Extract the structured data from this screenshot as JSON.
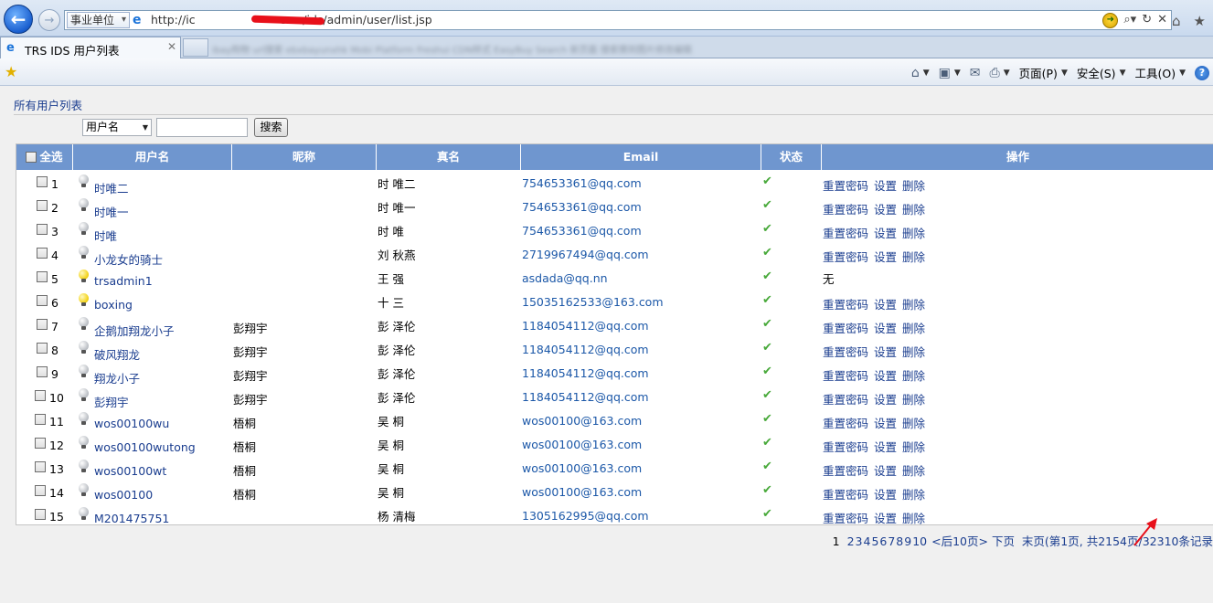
{
  "browser": {
    "zone_label": "事业单位",
    "url_prefix": "http://ic",
    "url_suffix": "c.cn/ids/admin/user/list.jsp",
    "tab_title": "TRS IDS 用户列表",
    "blurred_tabs": "ibay购物 url搜索   ebxbayunxhk   Mobi Platform   Freshui CDN样式   EasyBuy Search   新页面   搜索猜到图片修改编辑",
    "menu": {
      "page": "页面(P)",
      "safety": "安全(S)",
      "tools": "工具(O)"
    }
  },
  "page": {
    "breadcrumb": "所有用户列表",
    "search": {
      "field": "用户名",
      "value": "",
      "button": "搜索"
    },
    "table": {
      "headers": {
        "select_all": "全选",
        "username": "用户名",
        "nickname": "昵称",
        "realname": "真名",
        "email": "Email",
        "status": "状态",
        "actions": "操作"
      },
      "action_labels": {
        "reset": "重置密码",
        "settings": "设置",
        "delete": "删除"
      },
      "rows": [
        {
          "no": "1",
          "username": "时唯二",
          "nickname": "",
          "realname": "时 唯二",
          "email": "754653361@qq.com",
          "active": false,
          "actions": "links"
        },
        {
          "no": "2",
          "username": "时唯一",
          "nickname": "",
          "realname": "时 唯一",
          "email": "754653361@qq.com",
          "active": false,
          "actions": "links"
        },
        {
          "no": "3",
          "username": "时唯",
          "nickname": "",
          "realname": "时 唯",
          "email": "754653361@qq.com",
          "active": false,
          "actions": "links"
        },
        {
          "no": "4",
          "username": "小龙女的骑士",
          "nickname": "",
          "realname": "刘 秋燕",
          "email": "2719967494@qq.com",
          "active": false,
          "actions": "links"
        },
        {
          "no": "5",
          "username": "trsadmin1",
          "nickname": "",
          "realname": "王 强",
          "email": "asdada@qq.nn",
          "active": true,
          "actions": "无"
        },
        {
          "no": "6",
          "username": "boxing",
          "nickname": "",
          "realname": "十 三",
          "email": "15035162533@163.com",
          "active": true,
          "actions": "links"
        },
        {
          "no": "7",
          "username": "企鹅加翔龙小子",
          "nickname": "彭翔宇",
          "realname": "彭 泽伦",
          "email": "1184054112@qq.com",
          "active": false,
          "actions": "links"
        },
        {
          "no": "8",
          "username": "破风翔龙",
          "nickname": "彭翔宇",
          "realname": "彭 泽伦",
          "email": "1184054112@qq.com",
          "active": false,
          "actions": "links"
        },
        {
          "no": "9",
          "username": "翔龙小子",
          "nickname": "彭翔宇",
          "realname": "彭 泽伦",
          "email": "1184054112@qq.com",
          "active": false,
          "actions": "links"
        },
        {
          "no": "10",
          "username": "彭翔宇",
          "nickname": "彭翔宇",
          "realname": "彭 泽伦",
          "email": "1184054112@qq.com",
          "active": false,
          "actions": "links"
        },
        {
          "no": "11",
          "username": "wos00100wu",
          "nickname": "梧桐",
          "realname": "吴 桐",
          "email": "wos00100@163.com",
          "active": false,
          "actions": "links"
        },
        {
          "no": "12",
          "username": "wos00100wutong",
          "nickname": "梧桐",
          "realname": "吴 桐",
          "email": "wos00100@163.com",
          "active": false,
          "actions": "links"
        },
        {
          "no": "13",
          "username": "wos00100wt",
          "nickname": "梧桐",
          "realname": "吴 桐",
          "email": "wos00100@163.com",
          "active": false,
          "actions": "links"
        },
        {
          "no": "14",
          "username": "wos00100",
          "nickname": "梧桐",
          "realname": "吴 桐",
          "email": "wos00100@163.com",
          "active": false,
          "actions": "links"
        },
        {
          "no": "15",
          "username": "M201475751",
          "nickname": "",
          "realname": "杨 清梅",
          "email": "1305162995@qq.com",
          "active": false,
          "actions": "links"
        }
      ]
    },
    "pager": {
      "current": "1",
      "pages": [
        "2",
        "3",
        "4",
        "5",
        "6",
        "7",
        "8",
        "9",
        "10"
      ],
      "prev10": "<后10页>",
      "next": "下页",
      "last": "末页",
      "summary": "(第1页, 共2154页/32310条记录"
    }
  },
  "colors": {
    "header_bg": "#6f96cf",
    "link": "#1a3d8f",
    "status_ok": "#48a93a",
    "arrow": "#e8101a"
  }
}
